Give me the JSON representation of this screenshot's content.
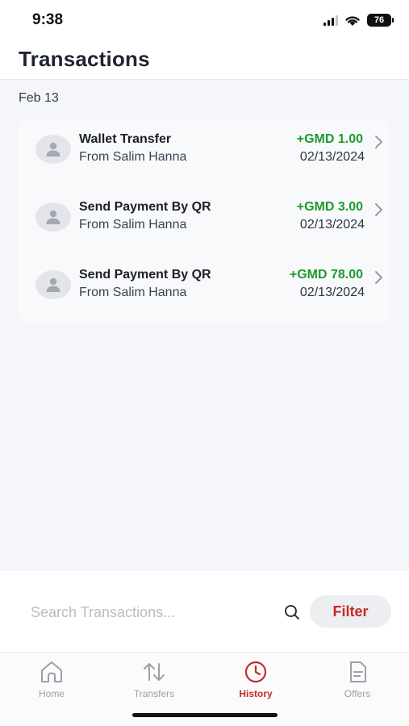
{
  "status_bar": {
    "time": "9:38",
    "battery": "76"
  },
  "header": {
    "title": "Transactions"
  },
  "date_group": "Feb 13",
  "transactions": [
    {
      "title": "Wallet Transfer",
      "subtitle": "From Salim Hanna",
      "amount": "+GMD 1.00",
      "date": "02/13/2024"
    },
    {
      "title": "Send Payment By QR",
      "subtitle": "From Salim Hanna",
      "amount": "+GMD 3.00",
      "date": "02/13/2024"
    },
    {
      "title": "Send Payment By QR",
      "subtitle": "From Salim Hanna",
      "amount": "+GMD 78.00",
      "date": "02/13/2024"
    }
  ],
  "search": {
    "placeholder": "Search Transactions...",
    "filter_label": "Filter"
  },
  "tabs": [
    {
      "label": "Home",
      "icon": "home-icon"
    },
    {
      "label": "Transfers",
      "icon": "transfers-icon"
    },
    {
      "label": "History",
      "icon": "history-icon",
      "active": true
    },
    {
      "label": "Offers",
      "icon": "offers-icon"
    }
  ],
  "colors": {
    "accent": "#c62a2a",
    "positive_amount": "#1e9a2c",
    "content_bg": "#f5f6f9"
  }
}
